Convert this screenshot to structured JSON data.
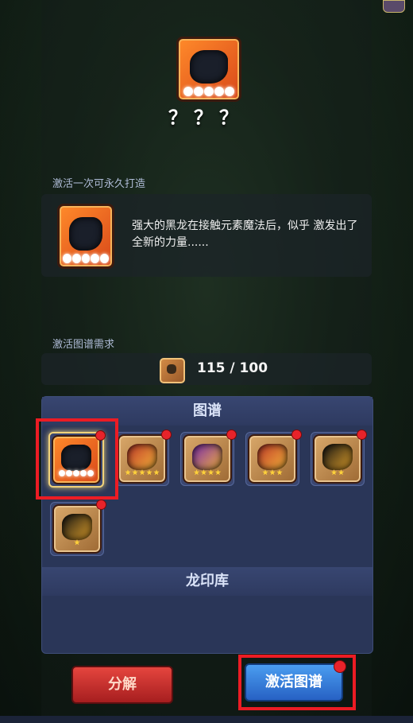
{
  "hero": {
    "name": "？？？",
    "star_count": 5
  },
  "forge_label": "激活一次可永久打造",
  "description": "强大的黑龙在接触元素魔法后，似乎 激发出了全新的力量......",
  "requirement_label": "激活图谱需求",
  "requirement": {
    "icon": "scroll-resource-icon",
    "count": "115 / 100"
  },
  "atlas": {
    "title": "图谱",
    "items": [
      {
        "icon": "black-dragon-icon",
        "stars": 5,
        "star_type": "white",
        "selected": true
      },
      {
        "icon": "red-dragon-icon",
        "stars": 5,
        "star_type": "gold"
      },
      {
        "icon": "purple-dragon-icon",
        "stars": 4,
        "star_type": "gold"
      },
      {
        "icon": "red-gold-dragon-icon",
        "stars": 3,
        "star_type": "gold"
      },
      {
        "icon": "black-gold-dragon-icon",
        "stars": 2,
        "star_type": "gold"
      },
      {
        "icon": "black-gold-dragon-icon",
        "stars": 1,
        "star_type": "gold"
      }
    ]
  },
  "seal_library": {
    "title": "龙印库"
  },
  "buttons": {
    "decompose": "分解",
    "activate": "激活图谱"
  },
  "colors": {
    "highlight": "#ec1c24",
    "notify_dot": "#e8232a",
    "activate_button": "#2761c4",
    "decompose_button": "#a61e1f"
  }
}
